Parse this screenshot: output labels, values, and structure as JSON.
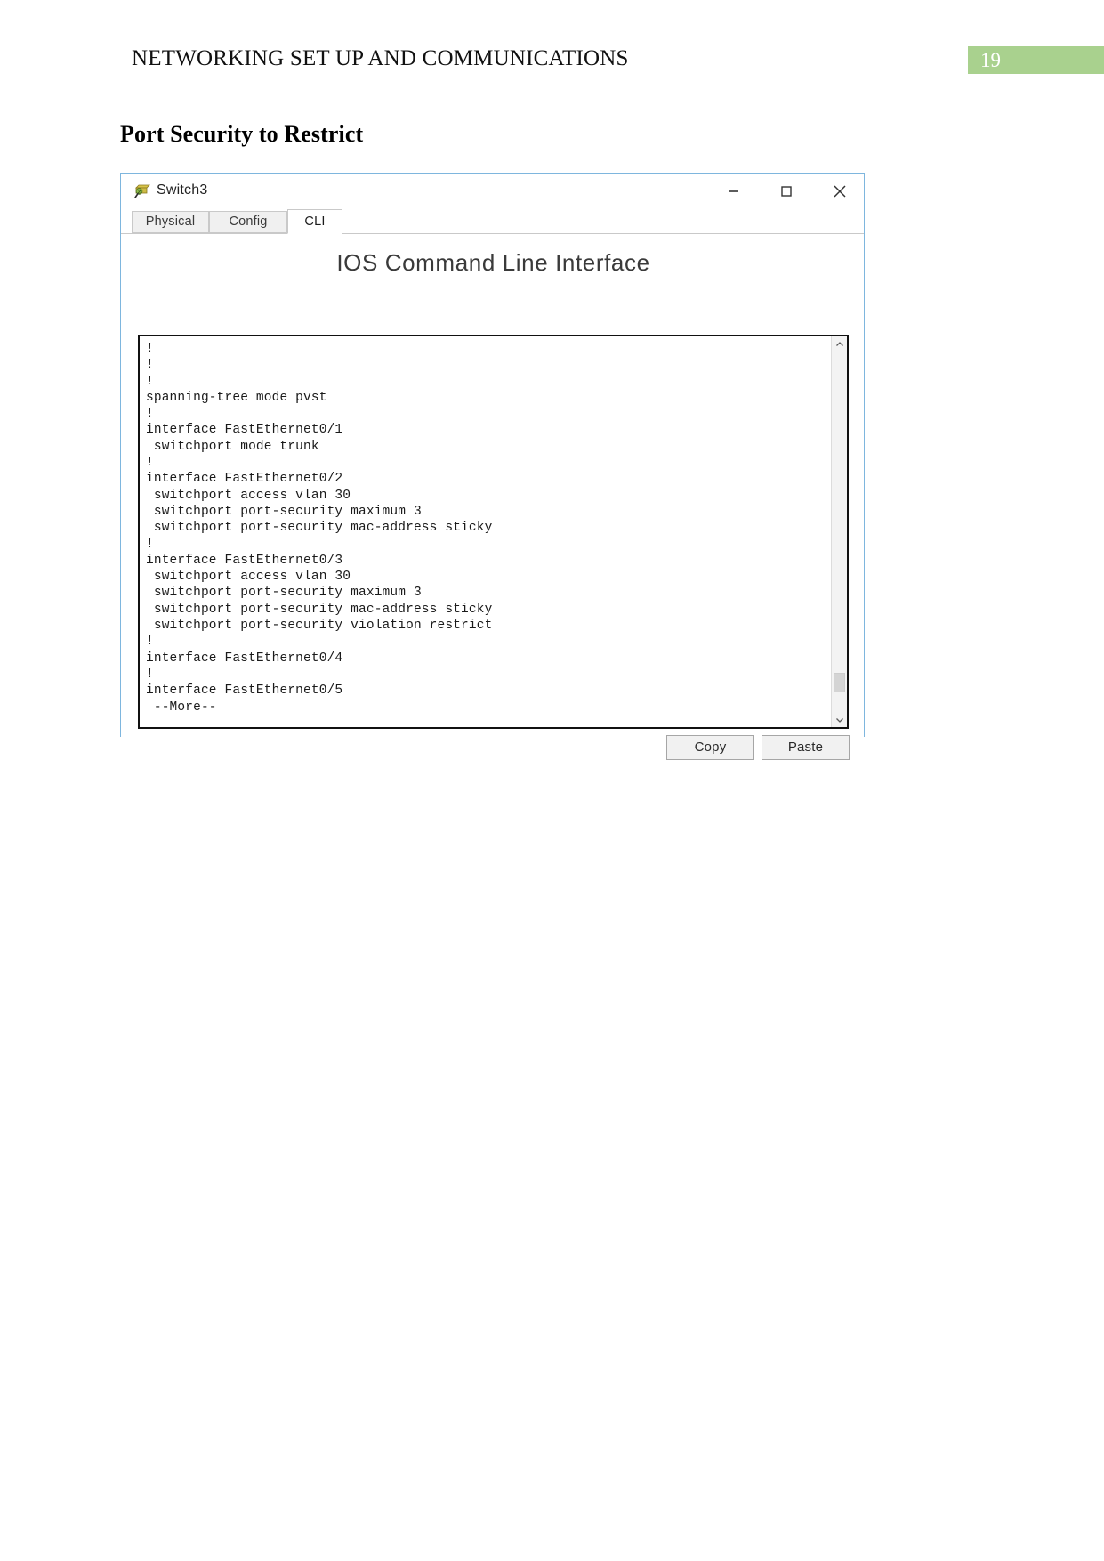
{
  "document": {
    "header_title": "NETWORKING SET UP AND COMMUNICATIONS",
    "page_number": "19",
    "page_number_badge_color": "#a9d18e",
    "section_heading": "Port Security to Restrict"
  },
  "window": {
    "title": "Switch3",
    "icon": "switch-device-icon",
    "border_color": "#7eb6de",
    "controls": {
      "minimize": "minimize-icon",
      "maximize": "maximize-icon",
      "close": "close-icon"
    },
    "tabs": [
      {
        "label": "Physical",
        "active": false
      },
      {
        "label": "Config",
        "active": false
      },
      {
        "label": "CLI",
        "active": true
      }
    ],
    "cli": {
      "heading": "IOS Command Line Interface",
      "terminal_text": "!\n!\n!\nspanning-tree mode pvst\n!\ninterface FastEthernet0/1\n switchport mode trunk\n!\ninterface FastEthernet0/2\n switchport access vlan 30\n switchport port-security maximum 3\n switchport port-security mac-address sticky\n!\ninterface FastEthernet0/3\n switchport access vlan 30\n switchport port-security maximum 3\n switchport port-security mac-address sticky\n switchport port-security violation restrict\n!\ninterface FastEthernet0/4\n!\ninterface FastEthernet0/5\n --More--",
      "scrollbar": {
        "up_arrow": "chevron-up-icon",
        "down_arrow": "chevron-down-icon"
      },
      "buttons": {
        "copy": "Copy",
        "paste": "Paste"
      }
    }
  }
}
